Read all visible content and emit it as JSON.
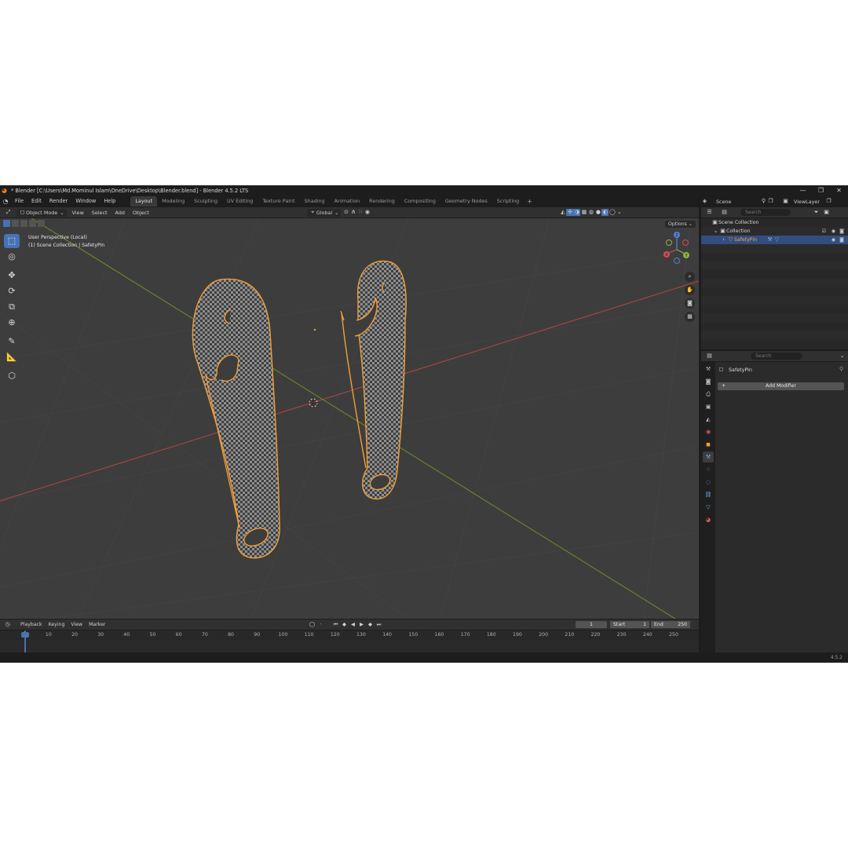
{
  "window": {
    "title": "* Blender [C:\\Users\\Md.Mominul Islam\\OneDrive\\Desktop\\Blender.blend] - Blender 4.5.2 LTS",
    "min": "—",
    "max": "❐",
    "close": "✕"
  },
  "menu": [
    "File",
    "Edit",
    "Render",
    "Window",
    "Help"
  ],
  "workspaces": {
    "tabs": [
      "Layout",
      "Modeling",
      "Sculpting",
      "UV Editing",
      "Texture Paint",
      "Shading",
      "Animation",
      "Rendering",
      "Compositing",
      "Geometry Nodes",
      "Scripting"
    ],
    "active": "Layout",
    "add": "+"
  },
  "viewport_header": {
    "mode": "Object Mode",
    "menus": [
      "View",
      "Select",
      "Add",
      "Object"
    ],
    "orientation": "Global",
    "options": "Options"
  },
  "viewport": {
    "perspective": "User Perspective (Local)",
    "collection_path": "(1) Scene Collection | SafetyPin",
    "gizmo": {
      "x": "X",
      "y": "Y",
      "z": "Z"
    },
    "colors": {
      "x_axis": "#c04545",
      "y_axis": "#7a9a2a",
      "selection": "#f29f38",
      "background": "#3d3d3d"
    }
  },
  "timeline": {
    "editor": "◷",
    "menus": [
      "Playback",
      "Keying",
      "View",
      "Marker"
    ],
    "current_frame": "1",
    "start_label": "Start",
    "start": "1",
    "end_label": "End",
    "end": "250",
    "ticks": [
      "1",
      "10",
      "20",
      "30",
      "40",
      "50",
      "60",
      "70",
      "80",
      "90",
      "100",
      "110",
      "120",
      "130",
      "140",
      "150",
      "160",
      "170",
      "180",
      "190",
      "200",
      "210",
      "220",
      "230",
      "240",
      "250"
    ]
  },
  "top_right": {
    "scene": "Scene",
    "view_layer": "ViewLayer"
  },
  "outliner": {
    "search_placeholder": "Search",
    "scene_collection": "Scene Collection",
    "collection": "Collection",
    "object": "SafetyPin"
  },
  "properties": {
    "search_placeholder": "Search",
    "object_name": "SafetyPin",
    "add_modifier": "Add Modifier"
  },
  "status": {
    "version": "4.5.2"
  }
}
